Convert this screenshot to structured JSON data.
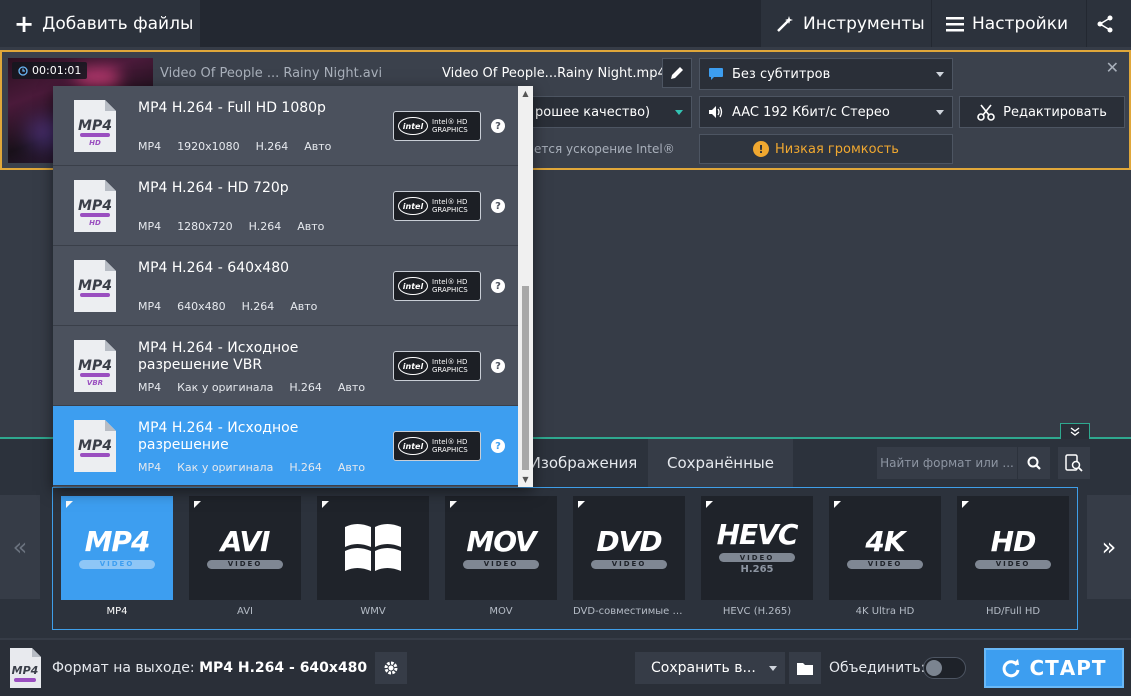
{
  "topbar": {
    "add_files": "Добавить файлы",
    "tools": "Инструменты",
    "settings": "Настройки"
  },
  "file": {
    "duration": "00:01:01",
    "source_name": "Video Of People ... Rainy Night.avi",
    "output_name": "Video Of People...Rainy Night.mp4",
    "subtitles": "Без субтитров",
    "quality": "рошее качество)",
    "audio": "AAC 192 Кбит/с Стерео",
    "edit": "Редактировать",
    "intel_note": "ется ускорение Intel®",
    "low_volume": "Низкая громкость",
    "close": "✕"
  },
  "presets": [
    {
      "name": "MP4 H.264 - Full HD 1080p",
      "icon_badge": "HD",
      "specs": [
        "MP4",
        "1920x1080",
        "H.264",
        "Авто"
      ],
      "selected": false
    },
    {
      "name": "MP4 H.264 - HD 720p",
      "icon_badge": "HD",
      "specs": [
        "MP4",
        "1280x720",
        "H.264",
        "Авто"
      ],
      "selected": false
    },
    {
      "name": "MP4 H.264 - 640x480",
      "icon_badge": "",
      "specs": [
        "MP4",
        "640x480",
        "H.264",
        "Авто"
      ],
      "selected": false
    },
    {
      "name": "MP4 H.264 - Исходное разрешение VBR",
      "icon_badge": "VBR",
      "specs": [
        "MP4",
        "Как у оригинала",
        "H.264",
        "Авто"
      ],
      "selected": false
    },
    {
      "name": "MP4 H.264 - Исходное разрешение",
      "icon_badge": "",
      "specs": [
        "MP4",
        "Как у оригинала",
        "H.264",
        "Авто"
      ],
      "selected": true
    }
  ],
  "intel_badge": {
    "logo": "intel",
    "line1": "Intel® HD",
    "line2": "GRAPHICS"
  },
  "categories": {
    "images": "Изображения",
    "saved": "Сохранённые"
  },
  "search": {
    "placeholder": "Найти формат или ..."
  },
  "formats": [
    {
      "big": "MP4",
      "sub": "VIDEO",
      "label": "MP4",
      "active": true
    },
    {
      "big": "AVI",
      "sub": "VIDEO",
      "label": "AVI",
      "active": false
    },
    {
      "big": "",
      "sub": "",
      "label": "WMV",
      "active": false,
      "icon": "windows-logo"
    },
    {
      "big": "MOV",
      "sub": "VIDEO",
      "label": "MOV",
      "active": false
    },
    {
      "big": "DVD",
      "sub": "VIDEO",
      "label": "DVD-совместимые в...",
      "active": false
    },
    {
      "big": "HEVC",
      "sub": "VIDEO",
      "sub2": "H.265",
      "label": "HEVC (H.265)",
      "active": false
    },
    {
      "big": "4K",
      "sub": "VIDEO",
      "label": "4K Ultra HD",
      "active": false
    },
    {
      "big": "HD",
      "sub": "VIDEO",
      "label": "HD/Full HD",
      "active": false
    }
  ],
  "nav": {
    "left": "«",
    "right": "»"
  },
  "bottom": {
    "output_label": "Формат на выходе:",
    "output_value": "MP4 H.264 - 640x480",
    "save_to": "Сохранить в...",
    "merge": "Объединить:",
    "start": "СТАРТ"
  },
  "colors": {
    "accent": "#3d9ef0",
    "highlight": "#e0a73a",
    "teal": "#2fa88f",
    "warning": "#f0a830"
  }
}
